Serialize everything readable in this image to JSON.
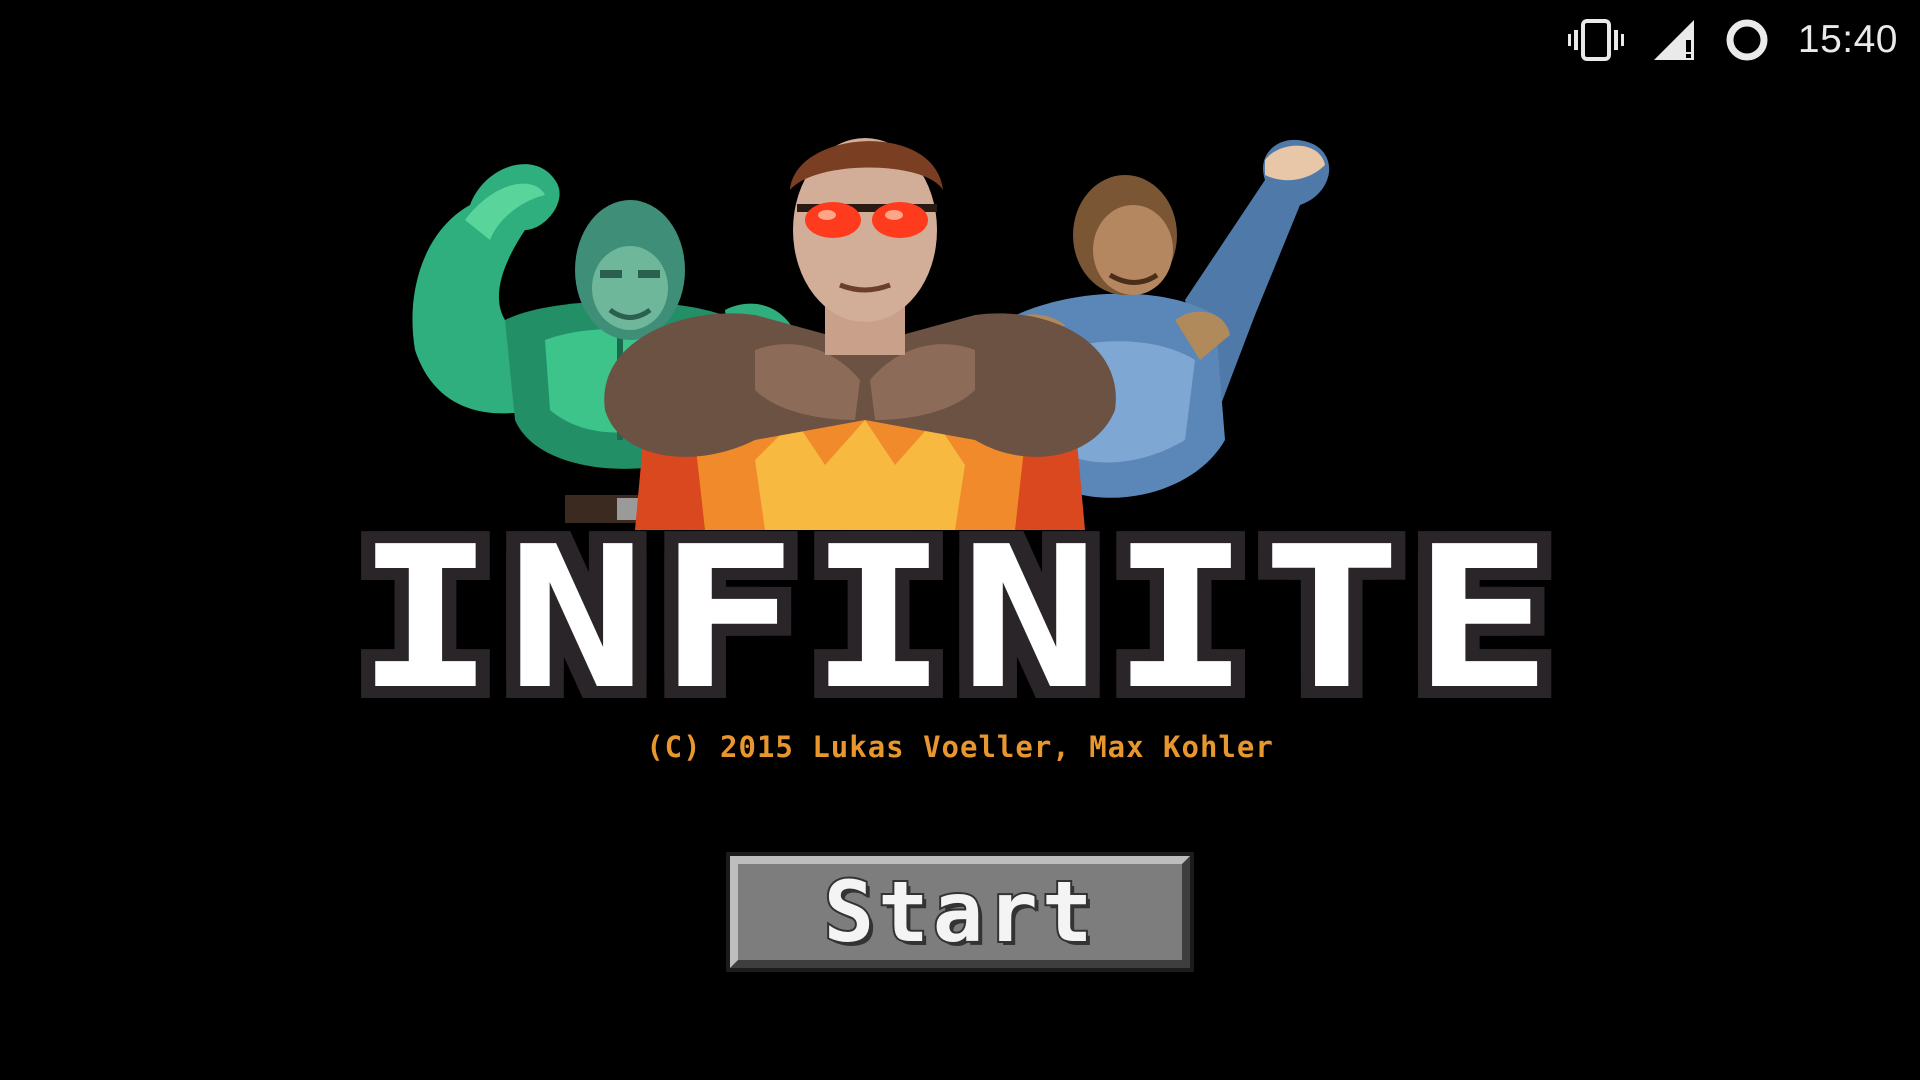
{
  "status_bar": {
    "time": "15:40",
    "icons": [
      "vibrate-icon",
      "cell-signal-icon",
      "loading-ring-icon"
    ]
  },
  "hero": {
    "characters": [
      "green-muscle-hero",
      "red-glasses-hero",
      "blue-armor-hero"
    ]
  },
  "title": "INFINITE",
  "copyright": "(C) 2015 Lukas Voeller, Max Kohler",
  "start_button": {
    "label": "Start"
  },
  "colors": {
    "background": "#000000",
    "title_fill": "#ffffff",
    "title_outline": "#2a2528",
    "copyright": "#e8962e",
    "button_face": "#7d7d7d"
  }
}
